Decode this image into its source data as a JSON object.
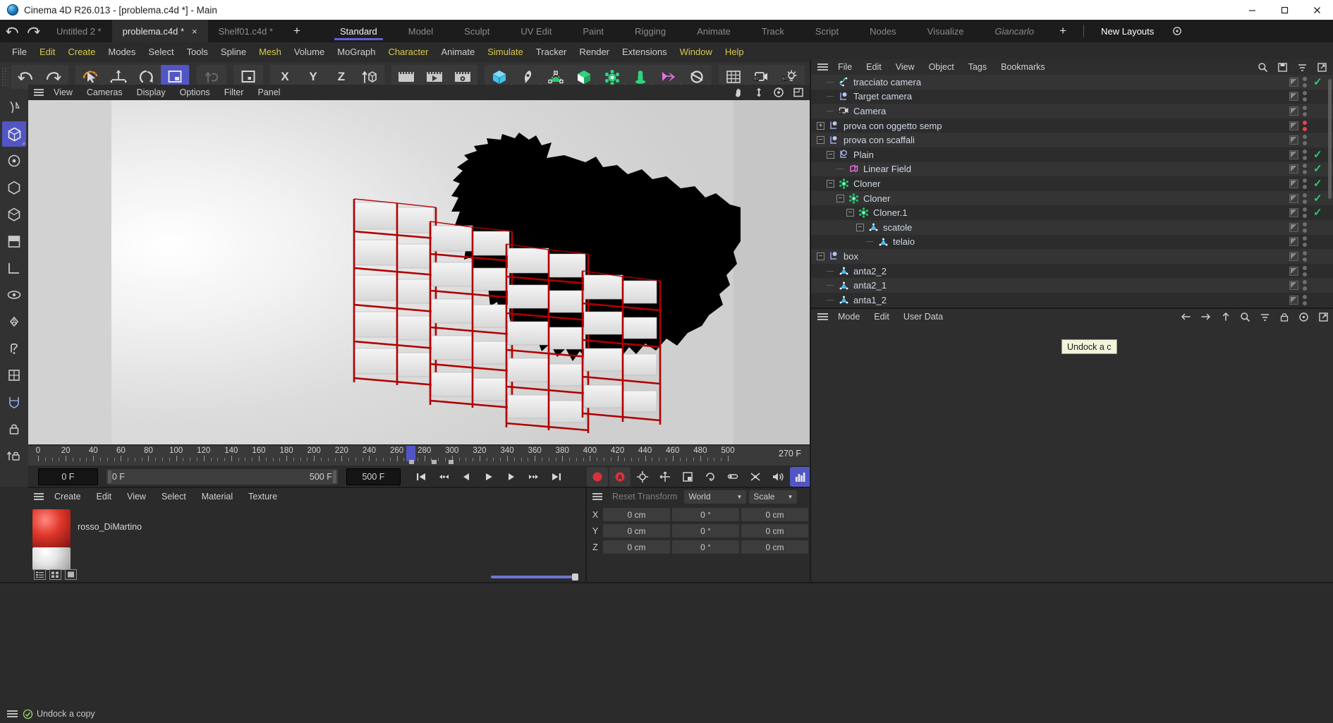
{
  "window": {
    "title": "Cinema 4D R26.013 - [problema.c4d *] - Main",
    "logo_icon": "cinema4d-logo-icon",
    "minimize_icon": "minimize-icon",
    "maximize_icon": "maximize-icon",
    "close_icon": "close-icon"
  },
  "tabbar": {
    "undo_icon": "undo-icon",
    "redo_icon": "redo-icon",
    "file_tabs": [
      {
        "label": "Untitled 2 *",
        "active": false,
        "closable": false
      },
      {
        "label": "problema.c4d *",
        "active": true,
        "closable": true,
        "close_label": "×"
      },
      {
        "label": "Shelf01.c4d *",
        "active": false,
        "closable": false
      }
    ],
    "add_tab_label": "+",
    "layout_tabs": [
      {
        "label": "Standard",
        "active": true
      },
      {
        "label": "Model",
        "active": false
      },
      {
        "label": "Sculpt",
        "active": false
      },
      {
        "label": "UV Edit",
        "active": false
      },
      {
        "label": "Paint",
        "active": false
      },
      {
        "label": "Rigging",
        "active": false
      },
      {
        "label": "Animate",
        "active": false
      },
      {
        "label": "Track",
        "active": false
      },
      {
        "label": "Script",
        "active": false
      },
      {
        "label": "Nodes",
        "active": false
      },
      {
        "label": "Visualize",
        "active": false
      },
      {
        "label": "Giancarlo",
        "active": false,
        "italic": true
      }
    ],
    "add_layout_label": "+",
    "new_layouts_label": "New Layouts"
  },
  "menubar": {
    "items": [
      {
        "label": "File",
        "highlight": false
      },
      {
        "label": "Edit",
        "highlight": true
      },
      {
        "label": "Create",
        "highlight": true
      },
      {
        "label": "Modes",
        "highlight": false
      },
      {
        "label": "Select",
        "highlight": false
      },
      {
        "label": "Tools",
        "highlight": false
      },
      {
        "label": "Spline",
        "highlight": false
      },
      {
        "label": "Mesh",
        "highlight": true
      },
      {
        "label": "Volume",
        "highlight": false
      },
      {
        "label": "MoGraph",
        "highlight": false
      },
      {
        "label": "Character",
        "highlight": true
      },
      {
        "label": "Animate",
        "highlight": false
      },
      {
        "label": "Simulate",
        "highlight": true
      },
      {
        "label": "Tracker",
        "highlight": false
      },
      {
        "label": "Render",
        "highlight": false
      },
      {
        "label": "Extensions",
        "highlight": false
      },
      {
        "label": "Window",
        "highlight": true
      },
      {
        "label": "Help",
        "highlight": true
      }
    ]
  },
  "toolbar": {
    "groups": [
      {
        "items": [
          {
            "icon": "undo-icon",
            "name": "undo-button",
            "selected": false
          },
          {
            "icon": "redo-icon",
            "name": "redo-button",
            "selected": false
          }
        ]
      },
      {
        "items": [
          {
            "icon": "live-selection-icon",
            "name": "live-selection-tool",
            "selected": false
          },
          {
            "icon": "move-icon",
            "name": "move-tool",
            "selected": false
          },
          {
            "icon": "rotate-icon",
            "name": "rotate-tool",
            "selected": false
          },
          {
            "icon": "scale-icon",
            "name": "scale-tool",
            "selected": true
          }
        ]
      },
      {
        "items": [
          {
            "icon": "undo-view-icon",
            "name": "undo-view-button",
            "selected": false,
            "dim": true
          }
        ]
      },
      {
        "items": [
          {
            "icon": "world-object-axis-icon",
            "name": "coordinate-system-toggle",
            "selected": false
          }
        ]
      },
      {
        "items": [
          {
            "icon": "x-axis-icon",
            "name": "x-axis-lock",
            "selected": false
          },
          {
            "icon": "y-axis-icon",
            "name": "y-axis-lock",
            "selected": false
          },
          {
            "icon": "z-axis-icon",
            "name": "z-axis-lock",
            "selected": false
          },
          {
            "icon": "world-axis-icon",
            "name": "world-axis-toggle",
            "selected": false
          }
        ]
      },
      {
        "items": [
          {
            "icon": "render-view-icon",
            "name": "render-view-button",
            "selected": false
          },
          {
            "icon": "render-region-icon",
            "name": "render-region-button",
            "selected": false
          },
          {
            "icon": "render-settings-icon",
            "name": "render-settings-button",
            "selected": false
          }
        ]
      },
      {
        "items": [
          {
            "icon": "cube-primitive-icon",
            "name": "add-cube-button",
            "selected": false
          },
          {
            "icon": "spline-pen-icon",
            "name": "spline-pen-button",
            "selected": false
          },
          {
            "icon": "nurbs-generator-icon",
            "name": "generator-button",
            "selected": false
          },
          {
            "icon": "array-icon",
            "name": "array-button",
            "selected": false
          },
          {
            "icon": "deformer-icon",
            "name": "deformer-button",
            "selected": false
          },
          {
            "icon": "environment-icon",
            "name": "environment-button",
            "selected": false
          },
          {
            "icon": "mograph-icon",
            "name": "mograph-button",
            "selected": false
          },
          {
            "icon": "light-icon",
            "name": "light-button",
            "selected": false
          }
        ]
      },
      {
        "items": [
          {
            "icon": "grid-icon",
            "name": "grid-button",
            "selected": false
          },
          {
            "icon": "stage-camera-icon",
            "name": "stage-camera-button",
            "selected": false
          },
          {
            "icon": "stage-light-icon",
            "name": "stage-light-button",
            "selected": false
          }
        ]
      }
    ]
  },
  "left_palette": [
    {
      "icon": "point-mode-icon",
      "name": "point-mode-button",
      "selected": false
    },
    {
      "icon": "model-mode-icon",
      "name": "model-mode-button",
      "selected": true
    },
    {
      "icon": "object-axis-icon",
      "name": "object-axis-mode-button",
      "selected": false
    },
    {
      "icon": "polygon-mode-icon",
      "name": "polygon-mode-button",
      "selected": false
    },
    {
      "icon": "edge-mode-icon",
      "name": "edge-mode-button",
      "selected": false
    },
    {
      "icon": "vertex-mode-icon",
      "name": "vertex-mode-button",
      "selected": false
    },
    {
      "icon": "texture-mode-icon",
      "name": "texture-axis-button",
      "selected": false
    },
    {
      "icon": "workplane-icon",
      "name": "workplane-button",
      "selected": false
    },
    {
      "icon": "viewport-solo-icon",
      "name": "viewport-solo-button",
      "selected": false
    },
    {
      "icon": "annotation-icon",
      "name": "annotation-button",
      "selected": false
    },
    {
      "icon": "enable-axis-icon",
      "name": "enable-axis-button",
      "selected": false
    },
    {
      "icon": "snap-icon",
      "name": "snap-button",
      "selected": false
    },
    {
      "icon": "lock-icon",
      "name": "lock-button",
      "selected": false
    },
    {
      "icon": "workplane-lock-icon",
      "name": "workplane-lock-button",
      "selected": false
    }
  ],
  "viewport": {
    "menu": [
      "View",
      "Cameras",
      "Display",
      "Options",
      "Filter",
      "Panel"
    ],
    "burger_icon": "viewport-menu-icon",
    "right_icons": [
      "pan-icon",
      "dolly-icon",
      "orbit-icon",
      "maximize-viewport-icon"
    ]
  },
  "timeline": {
    "ticks": [
      0,
      20,
      40,
      60,
      80,
      100,
      120,
      140,
      160,
      180,
      200,
      220,
      240,
      260,
      280,
      300,
      320,
      340,
      360,
      380,
      400,
      420,
      440,
      460,
      480,
      500
    ],
    "range_start": 0,
    "range_end": 500,
    "current_frame": 270,
    "current_frame_label": "270 F",
    "playhead_label": "270"
  },
  "transport": {
    "start_field": "0 F",
    "range_left": "0 F",
    "range_right": "500 F",
    "end_field": "500 F",
    "buttons": [
      {
        "icon": "go-to-start-icon",
        "name": "go-to-start-button"
      },
      {
        "icon": "prev-keyframe-icon",
        "name": "previous-keyframe-button"
      },
      {
        "icon": "step-back-icon",
        "name": "step-back-button"
      },
      {
        "icon": "play-icon",
        "name": "play-button"
      },
      {
        "icon": "step-forward-icon",
        "name": "step-forward-button"
      },
      {
        "icon": "next-keyframe-icon",
        "name": "next-keyframe-button"
      },
      {
        "icon": "go-to-end-icon",
        "name": "go-to-end-button"
      }
    ],
    "record_buttons": [
      {
        "icon": "record-active-objects-icon",
        "name": "record-button",
        "color": "#d8333a",
        "active": false
      },
      {
        "icon": "autokeying-icon",
        "name": "autokeying-button",
        "color": "#d8333a",
        "active": false
      },
      {
        "icon": "keyframe-settings-icon",
        "name": "keyframe-selection-button",
        "active": false
      },
      {
        "icon": "position-key-icon",
        "name": "position-key-button",
        "active": false
      },
      {
        "icon": "scale-key-icon",
        "name": "scale-key-button",
        "active": false
      },
      {
        "icon": "rotation-key-icon",
        "name": "rotation-key-button",
        "active": false
      },
      {
        "icon": "param-key-icon",
        "name": "parameter-key-button",
        "active": false
      },
      {
        "icon": "pla-key-icon",
        "name": "point-level-animation-button",
        "active": false
      },
      {
        "icon": "sound-icon",
        "name": "sound-button",
        "active": false
      },
      {
        "icon": "level-of-detail-icon",
        "name": "level-of-detail-button",
        "active": true
      }
    ]
  },
  "material_manager": {
    "burger_icon": "material-menu-icon",
    "menu": [
      "Create",
      "Edit",
      "View",
      "Select",
      "Material",
      "Texture"
    ],
    "materials": [
      {
        "name": "rosso_DiMartino",
        "swatch_color": "#e0372b"
      }
    ],
    "footer_icons": [
      "list-view-icon",
      "grid-view-icon",
      "large-preview-icon"
    ],
    "zoom_slider_value": 100
  },
  "coordinates": {
    "burger_icon": "coordinates-menu-icon",
    "reset_label": "Reset Transform",
    "space_label": "World",
    "mode_label": "Scale",
    "rows": [
      {
        "axis": "X",
        "position": "0 cm",
        "rotation": "0 °",
        "size": "0 cm"
      },
      {
        "axis": "Y",
        "position": "0 cm",
        "rotation": "0 °",
        "size": "0 cm"
      },
      {
        "axis": "Z",
        "position": "0 cm",
        "rotation": "0 °",
        "size": "0 cm"
      }
    ]
  },
  "object_manager": {
    "burger_icon": "object-menu-icon",
    "menu": [
      "File",
      "Edit",
      "View",
      "Object",
      "Tags",
      "Bookmarks"
    ],
    "right_icons": [
      "search-icon",
      "save-layout-icon",
      "filter-icon",
      "expand-icon"
    ],
    "objects": [
      {
        "name": "tracciato camera",
        "icon": "spline-icon",
        "depth": 1,
        "expander": "",
        "visible_check": true,
        "tags": []
      },
      {
        "name": "Target camera",
        "icon": "null-object-icon",
        "depth": 1,
        "expander": "",
        "visible_check": false,
        "tags": []
      },
      {
        "name": "Camera",
        "icon": "camera-icon",
        "depth": 1,
        "expander": "",
        "visible_check": false,
        "extra_icon": "target-tag-icon",
        "tags": [
          "protection-tag",
          "target-tag"
        ]
      },
      {
        "name": "prova con oggetto semp",
        "icon": "null-object-icon",
        "depth": 0,
        "expander": "+",
        "visible_check": false,
        "dots_red": true,
        "tags": []
      },
      {
        "name": "prova con scaffali",
        "icon": "null-object-icon",
        "depth": 0,
        "expander": "−",
        "visible_check": false,
        "tags": []
      },
      {
        "name": "Plain",
        "icon": "plain-effector-icon",
        "depth": 1,
        "expander": "−",
        "visible_check": true,
        "tags": []
      },
      {
        "name": "Linear Field",
        "icon": "linear-field-icon",
        "depth": 2,
        "expander": "",
        "visible_check": true,
        "tags": []
      },
      {
        "name": "Cloner",
        "icon": "cloner-icon",
        "depth": 1,
        "expander": "−",
        "visible_check": true,
        "tags": [
          "white-material"
        ]
      },
      {
        "name": "Cloner",
        "icon": "cloner-icon",
        "depth": 2,
        "expander": "−",
        "visible_check": true,
        "tags": []
      },
      {
        "name": "Cloner.1",
        "icon": "cloner-icon",
        "depth": 3,
        "expander": "−",
        "visible_check": true,
        "tags": []
      },
      {
        "name": "scatole",
        "icon": "polygon-object-icon",
        "depth": 4,
        "expander": "−",
        "visible_check": false,
        "tags": [
          "white-material"
        ]
      },
      {
        "name": "telaio",
        "icon": "polygon-object-icon",
        "depth": 5,
        "expander": "",
        "visible_check": false,
        "tags": [
          "dark-red-material"
        ]
      },
      {
        "name": "box",
        "icon": "null-object-icon",
        "depth": 0,
        "expander": "−",
        "visible_check": false,
        "tags": [
          "red-material"
        ]
      },
      {
        "name": "anta2_2",
        "icon": "polygon-object-icon",
        "depth": 1,
        "expander": "",
        "visible_check": false,
        "tags": [
          "selection-tag",
          "phong-tag"
        ]
      },
      {
        "name": "anta2_1",
        "icon": "polygon-object-icon",
        "depth": 1,
        "expander": "",
        "visible_check": false,
        "tags": [
          "selection-tag",
          "phong-tag"
        ]
      },
      {
        "name": "anta1_2",
        "icon": "polygon-object-icon",
        "depth": 1,
        "expander": "",
        "visible_check": false,
        "tags": [
          "selection-tag",
          "phong-tag"
        ]
      }
    ]
  },
  "attribute_manager": {
    "burger_icon": "attribute-menu-icon",
    "menu": [
      "Mode",
      "Edit",
      "User Data"
    ],
    "right_icons": [
      "back-arrow-icon",
      "forward-arrow-icon",
      "up-arrow-icon",
      "search-icon",
      "filter-icon",
      "lock-icon",
      "pin-icon",
      "expand-icon"
    ],
    "search_placeholder": ""
  },
  "tooltip": {
    "text": "Undock a c"
  },
  "statusbar": {
    "burger_icon": "status-menu-icon",
    "status_icon": "checkmark-circle-icon",
    "message": "Undock a copy"
  },
  "colors": {
    "accent_blue": "#5156c4",
    "menu_highlight": "#d8c84a",
    "checkmark_green": "#27d16a",
    "dot_red": "#e8434a",
    "panel_bg": "#2e2e2e",
    "toolbar_bg": "#323232",
    "titlebar_bg": "#ffffff"
  }
}
